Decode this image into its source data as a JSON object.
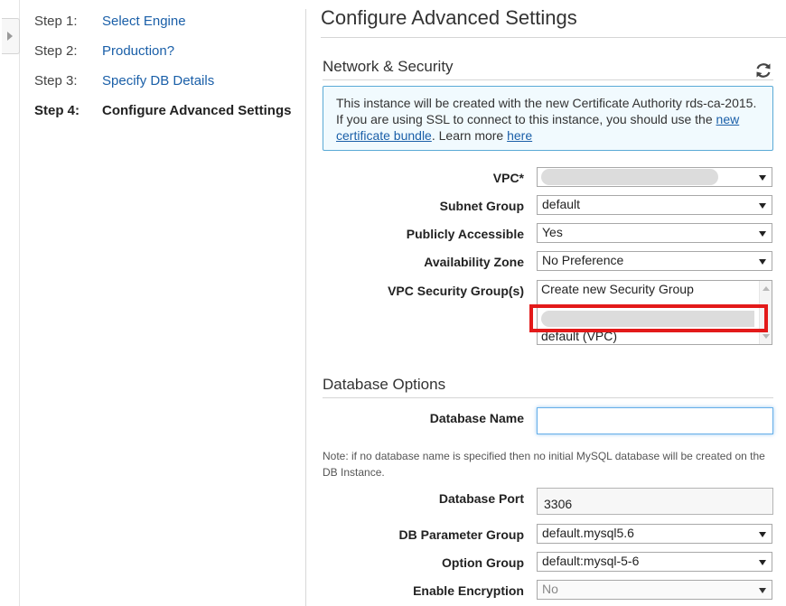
{
  "steps": [
    {
      "num": "Step 1:",
      "label": "Select Engine"
    },
    {
      "num": "Step 2:",
      "label": "Production?"
    },
    {
      "num": "Step 3:",
      "label": "Specify DB Details"
    },
    {
      "num": "Step 4:",
      "label": "Configure Advanced Settings"
    }
  ],
  "page_title": "Configure Advanced Settings",
  "network": {
    "heading": "Network & Security",
    "info": {
      "text_1": "This instance will be created with the new Certificate Authority rds-ca-2015. If you are using SSL to connect to this instance, you should use the ",
      "link_1": "new certificate bundle",
      "text_2": ". Learn more ",
      "link_2": "here"
    },
    "vpc_label": "VPC*",
    "subnet_label": "Subnet Group",
    "subnet_value": "default",
    "public_label": "Publicly Accessible",
    "public_value": "Yes",
    "az_label": "Availability Zone",
    "az_value": "No Preference",
    "sg_label": "VPC Security Group(s)",
    "sg_options": [
      "Create new Security Group",
      "default (VPC)"
    ]
  },
  "database": {
    "heading": "Database Options",
    "name_label": "Database Name",
    "name_value": "",
    "note": "Note: if no database name is specified then no initial MySQL database will be created on the DB Instance.",
    "port_label": "Database Port",
    "port_value": "3306",
    "param_label": "DB Parameter Group",
    "param_value": "default.mysql5.6",
    "option_label": "Option Group",
    "option_value": "default:mysql-5-6",
    "enc_label": "Enable Encryption",
    "enc_value": "No"
  },
  "colors": {
    "link": "#1a5fa8",
    "info_bg": "#f1fafe",
    "info_border": "#5aaad6",
    "highlight": "#e31a1a"
  },
  "icons": [
    "expand-arrow-icon",
    "refresh-icon",
    "dropdown-caret-icon"
  ]
}
